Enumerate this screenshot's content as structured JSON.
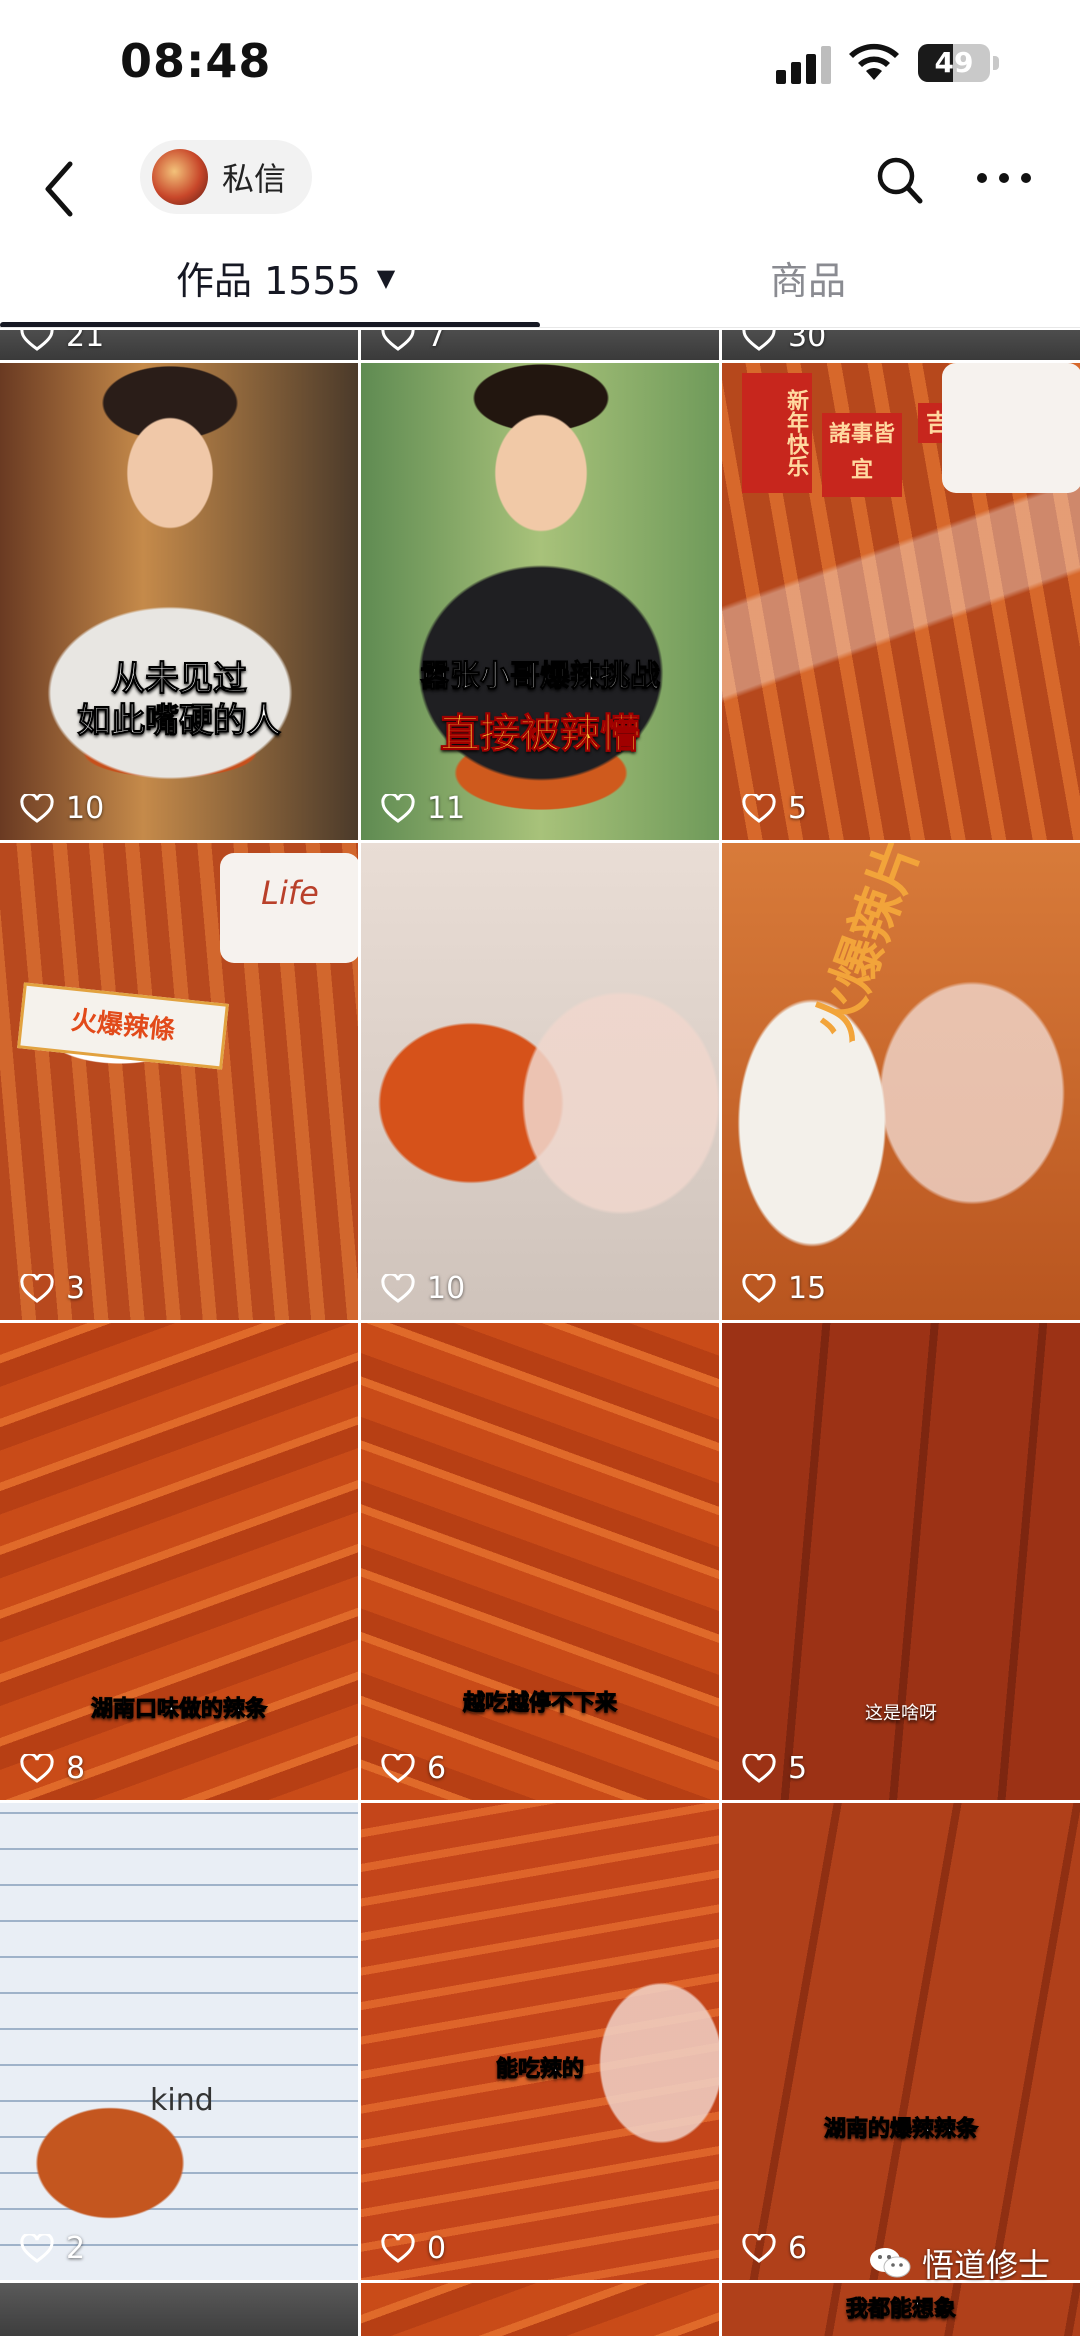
{
  "status_bar": {
    "time": "08:48",
    "battery": "49"
  },
  "nav": {
    "dm_label": "私信"
  },
  "tabs": {
    "works_label": "作品 1555",
    "works_caret": "▼",
    "goods_label": "商品"
  },
  "grid": {
    "top_likes": [
      "21",
      "7",
      "30"
    ],
    "cells": [
      {
        "likes": "10",
        "caption_lines": [
          "从未见过",
          "如此嘴硬的人"
        ]
      },
      {
        "likes": "11",
        "caption_lines": [
          "嚣张小哥爆辣挑战",
          "直接被辣懵"
        ]
      },
      {
        "likes": "5",
        "pack_words": [
          "新年快乐",
          "諸事皆宜",
          "吉"
        ]
      },
      {
        "likes": "3",
        "pack_words": [
          "火爆辣條",
          "Life"
        ]
      },
      {
        "likes": "10"
      },
      {
        "likes": "15",
        "pack_words": [
          "火爆辣片"
        ]
      },
      {
        "likes": "8",
        "caption": "湖南口味做的辣条"
      },
      {
        "likes": "6",
        "caption": "越吃越停不下来"
      },
      {
        "likes": "5",
        "caption": "这是啥呀"
      },
      {
        "likes": "2",
        "pack_words": [
          "kind"
        ]
      },
      {
        "likes": "0",
        "caption": "能吃辣的"
      },
      {
        "likes": "6",
        "caption": "湖南的爆辣辣条"
      }
    ],
    "bottom_caption": "我都能想象"
  },
  "watermark": {
    "text": "悟道修士"
  },
  "colors": {
    "text": "#161823",
    "muted": "#8a8b91",
    "chili": "#c94b18"
  },
  "icons": [
    "back-chevron-icon",
    "search-icon",
    "more-dots-icon",
    "heart-outline-icon",
    "wechat-icon"
  ]
}
